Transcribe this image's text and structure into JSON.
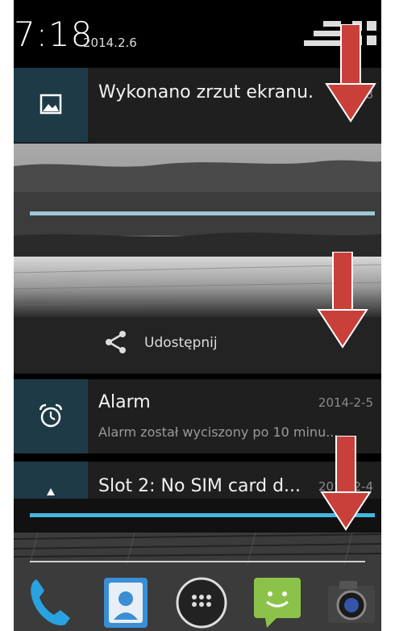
{
  "status_bar": {
    "time": "7:18",
    "date": "2014.2.6"
  },
  "notifications": {
    "screenshot": {
      "title": "Wykonano zrzut ekranu.",
      "time": "7:18",
      "share_label": "Udostępnij"
    },
    "alarm": {
      "title": "Alarm",
      "time": "2014-2-5",
      "subtitle": "Alarm został wyciszony po 10 minu..."
    },
    "sim": {
      "title": "Slot 2: No SIM card d...",
      "time": "2014-2-4"
    }
  },
  "icons": {
    "status_quick_settings": "quick-settings-icon",
    "status_grid": "grid-icon",
    "screenshot": "image-icon",
    "share": "share-icon",
    "alarm": "alarm-clock-icon",
    "sim": "warning-icon",
    "annotation": "red-down-arrow"
  },
  "dock": [
    "phone-icon",
    "contacts-icon",
    "app-drawer-icon",
    "messaging-icon",
    "camera-icon"
  ],
  "colors": {
    "accent": "#45b6de",
    "icon_box": "#1e3a47",
    "arrow": "#c9403a"
  }
}
